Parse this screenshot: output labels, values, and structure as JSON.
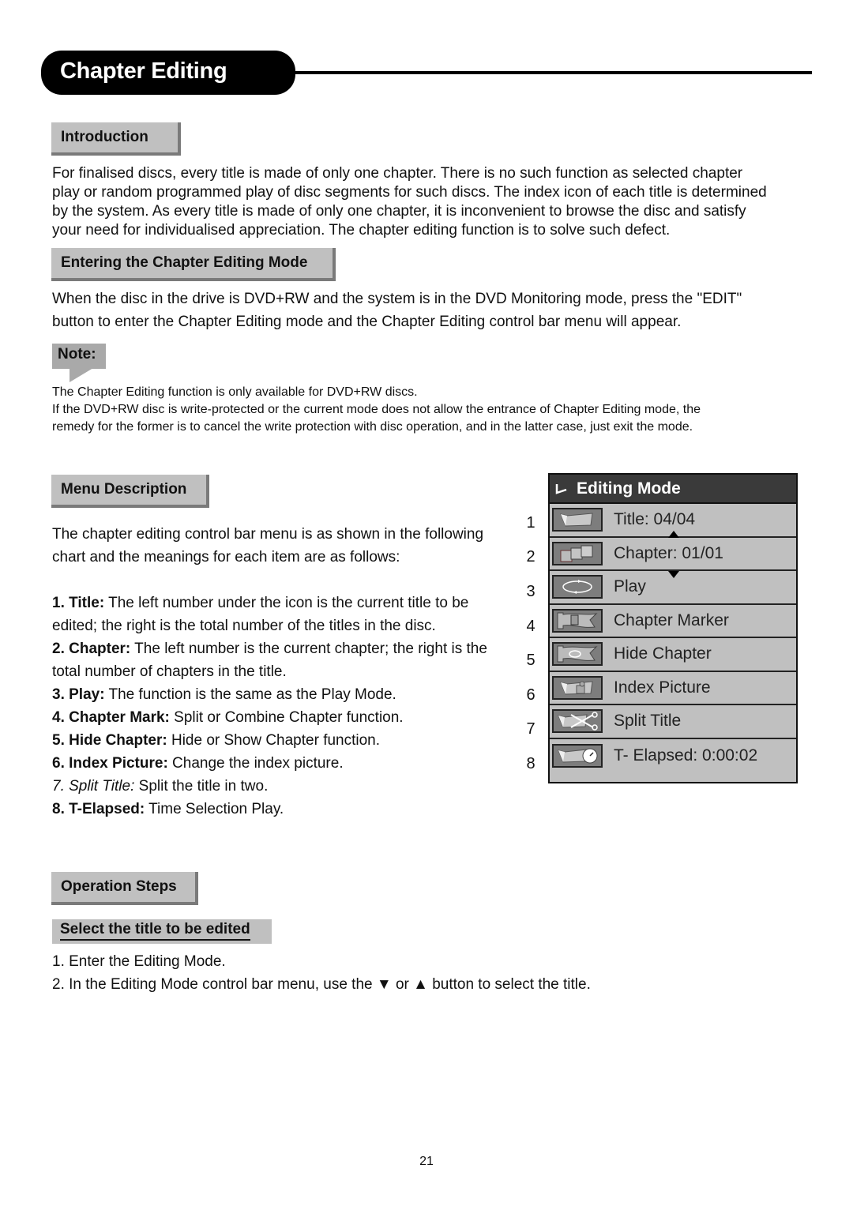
{
  "header": {
    "title": "Chapter Editing"
  },
  "sections": {
    "introduction": {
      "heading": "Introduction",
      "lines": [
        "For finalised discs, every title is made of only one chapter. There is no such function as selected chapter",
        "play or random programmed play of disc segments for such discs. The index icon of each title is determined",
        "by the system. As every title is made of only one chapter, it is inconvenient to browse the disc and satisfy",
        "your need for individualised appreciation. The chapter editing function is to solve such defect."
      ]
    },
    "entering": {
      "heading": "Entering the Chapter Editing Mode",
      "lines": [
        "When the disc in the drive is DVD+RW and the system is in the DVD Monitoring mode, press the \"EDIT\"",
        "button to enter the Chapter Editing mode and the Chapter Editing control bar menu will appear."
      ]
    },
    "note": {
      "label": "Note:",
      "lines": [
        "The Chapter Editing function is only available for DVD+RW discs.",
        "If the DVD+RW disc is write-protected or the current mode does not allow the entrance of Chapter Editing mode, the",
        "remedy for the former is to cancel the write protection with disc operation, and in the latter case, just exit the mode."
      ]
    },
    "menu_description": {
      "heading": "Menu Description",
      "intro_lines": [
        "The chapter editing control bar menu is as shown in the following",
        "chart and the meanings for each item are as follows:"
      ],
      "items": [
        {
          "term": "1. Title:",
          "text": " The left number under the icon is the current title to be",
          "cont": "edited; the right is the total number of the titles in the disc."
        },
        {
          "term": "2. Chapter:",
          "text": " The left number is the current chapter; the right is the",
          "cont": "total number of chapters in the title."
        },
        {
          "term": "3. Play:",
          "text": " The function is the same as the Play Mode."
        },
        {
          "term": "4. Chapter Mark:",
          "text": " Split or Combine Chapter function."
        },
        {
          "term": "5. Hide Chapter:",
          "text": " Hide or Show Chapter function."
        },
        {
          "term": "6. Index Picture:",
          "text": " Change the index picture."
        },
        {
          "term": "7. Split Title:",
          "text": " Split the title in two."
        },
        {
          "term": "8. T-Elapsed:",
          "text": " Time Selection Play."
        }
      ]
    },
    "operation": {
      "heading": "Operation Steps",
      "subheading": "Select the title to be edited",
      "steps": [
        "1. Enter the Editing Mode.",
        "2. In the Editing Mode control bar menu, use the ▼ or ▲ button to select the title."
      ]
    }
  },
  "editing_menu": {
    "title": "Editing Mode",
    "rows": [
      {
        "number": "1",
        "label": "Title: 04/04",
        "icon": "folder-icon"
      },
      {
        "number": "2",
        "label": "Chapter: 01/01",
        "icon": "chapters-icon"
      },
      {
        "number": "3",
        "label": "Play",
        "icon": "play-loop-icon"
      },
      {
        "number": "4",
        "label": "Chapter Marker",
        "icon": "chapter-marker-flag-icon"
      },
      {
        "number": "5",
        "label": "Hide Chapter",
        "icon": "hide-chapter-flag-icon"
      },
      {
        "number": "6",
        "label": "Index Picture",
        "icon": "index-picture-icon"
      },
      {
        "number": "7",
        "label": "Split Title",
        "icon": "scissors-icon"
      },
      {
        "number": "8",
        "label": "T- Elapsed: 0:00:02",
        "icon": "clock-icon"
      }
    ]
  },
  "footer": {
    "page_number": "21"
  }
}
